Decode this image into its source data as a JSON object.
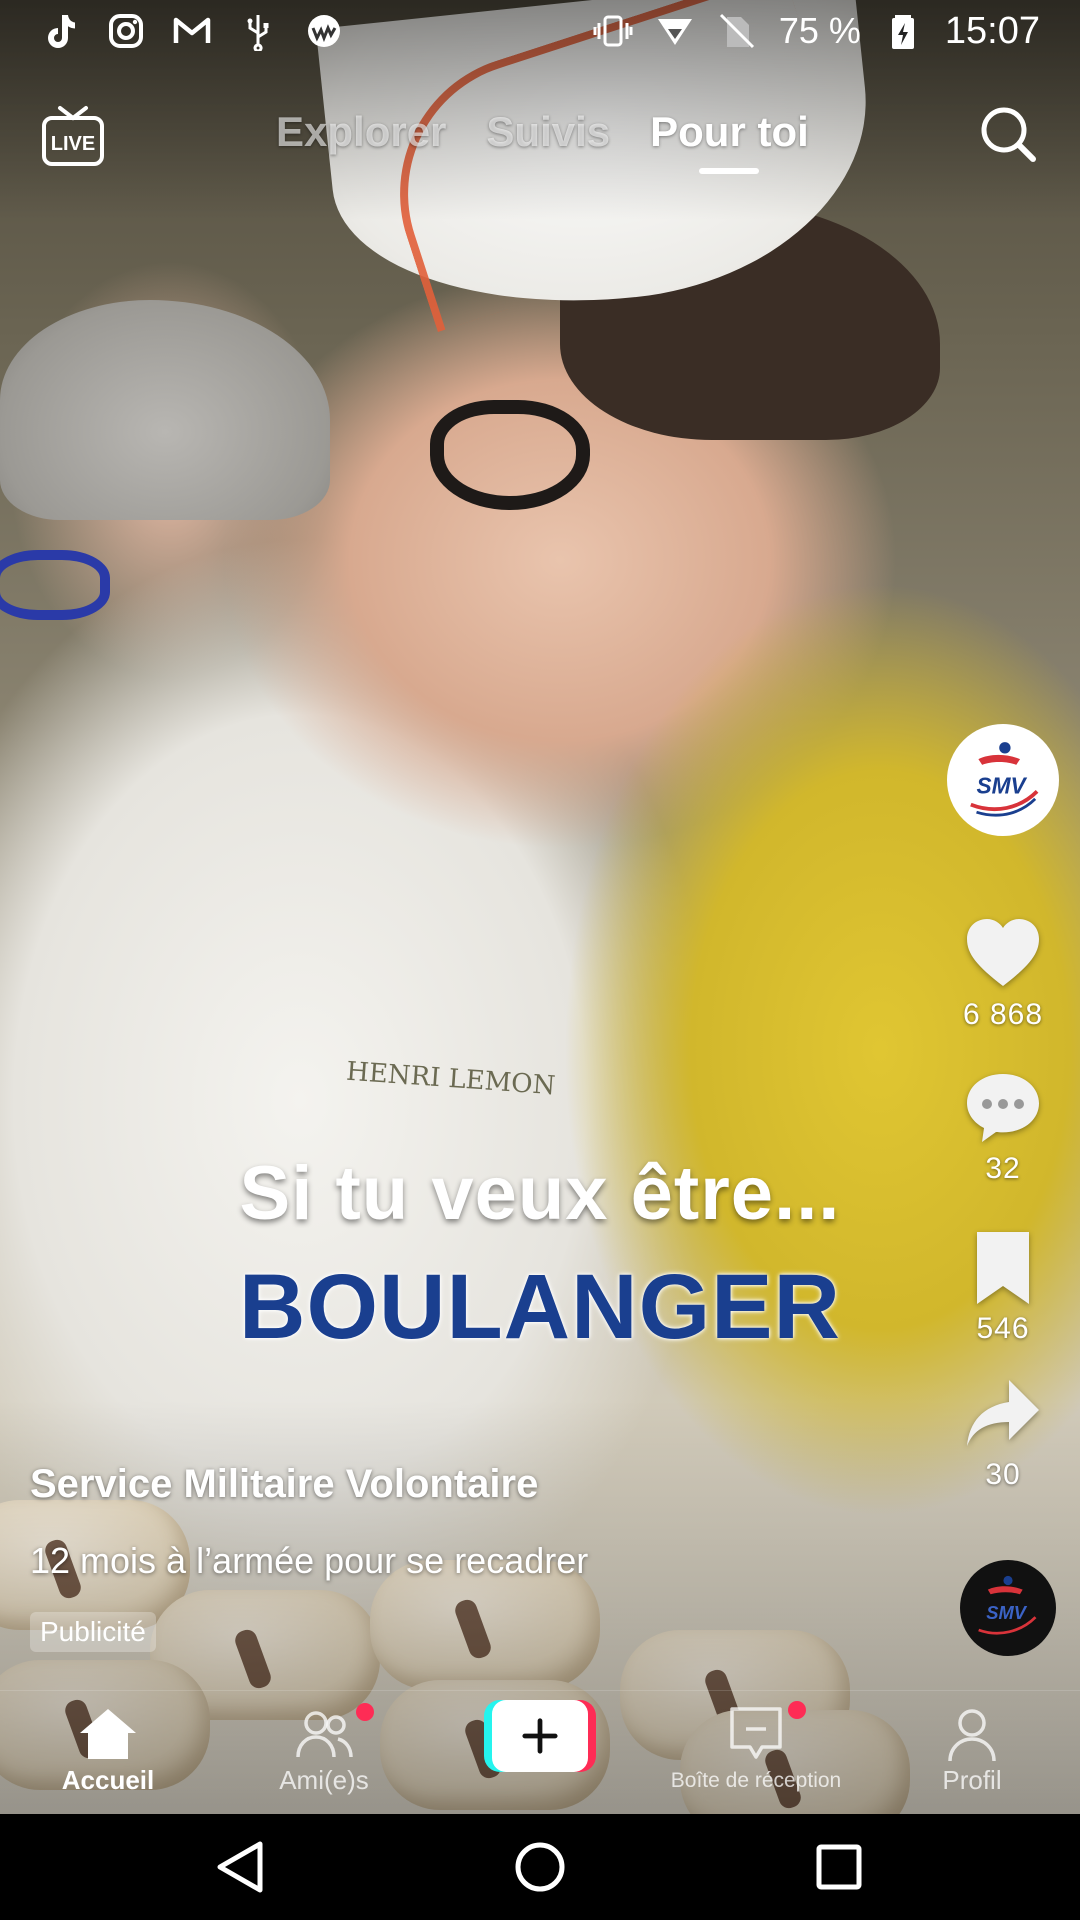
{
  "status_bar": {
    "battery": "75 %",
    "time": "15:07",
    "left_icons": [
      "tiktok-icon",
      "instagram-icon",
      "gmail-icon",
      "usb-icon",
      "app-icon"
    ],
    "right_icons": [
      "vibrate-icon",
      "signal-icon",
      "no-sim-icon",
      "battery-icon"
    ]
  },
  "top_nav": {
    "live_label": "LIVE",
    "tabs": [
      {
        "label": "Explorer",
        "active": false
      },
      {
        "label": "Suivis",
        "active": false
      },
      {
        "label": "Pour toi",
        "active": true
      }
    ]
  },
  "video": {
    "caption_line1": "Si tu veux être...",
    "caption_line2": "BOULANGER",
    "apron_text": "HENRI LEMON",
    "author": "Service Militaire Volontaire",
    "description": "12 mois à l’armée pour se recadrer",
    "ad_label": "Publicité",
    "avatar_text": "SMV"
  },
  "actions": {
    "likes": "6 868",
    "comments": "32",
    "saves": "546",
    "shares": "30"
  },
  "bottom_nav": {
    "items": [
      {
        "label": "Accueil",
        "icon": "home-icon",
        "active": true
      },
      {
        "label": "Ami(e)s",
        "icon": "friends-icon",
        "active": false
      },
      {
        "label": "Boîte de réception",
        "icon": "inbox-icon",
        "active": false
      },
      {
        "label": "Profil",
        "icon": "profile-icon",
        "active": false
      }
    ]
  },
  "colors": {
    "accent_red": "#fe2c55",
    "accent_cyan": "#25f4ee",
    "caption_blue": "#1a3f8f"
  }
}
